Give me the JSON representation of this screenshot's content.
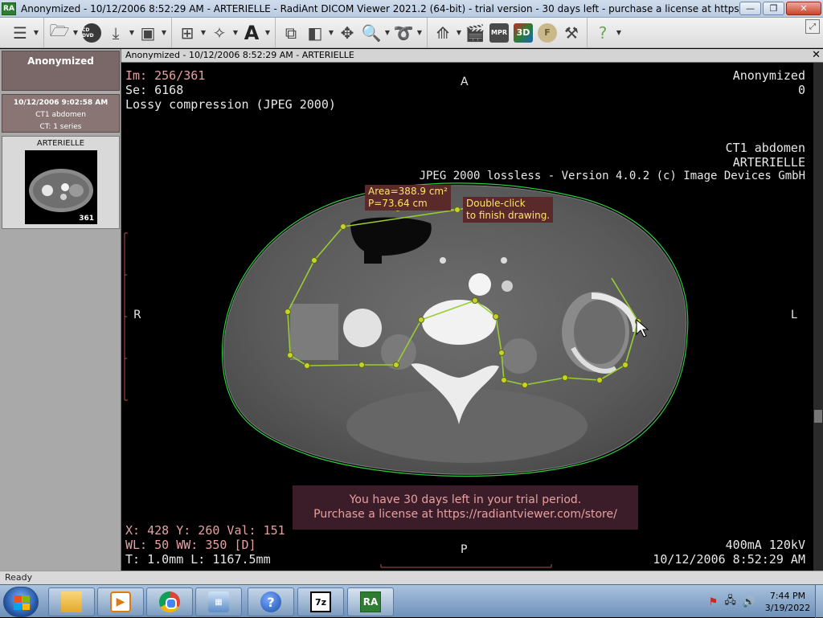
{
  "window": {
    "icon_text": "RA",
    "title": "Anonymized - 10/12/2006 8:52:29 AM - ARTERIELLE - RadiAnt DICOM Viewer 2021.2 (64-bit) - trial version - 30 days left - purchase a license at https://radiantviewer.com...",
    "minimize": "—",
    "maximize": "❐",
    "close": "✕"
  },
  "toolbar": {
    "icons": [
      "menu-icon",
      "folder-open-icon",
      "cd-dvd-icon",
      "download-icon",
      "save-icon",
      "layout-grid-icon",
      "pan-tool-icon",
      "annotation-text-icon",
      "series-stack-icon",
      "window-level-icon",
      "move-icon",
      "zoom-icon",
      "roi-freehand-icon",
      "mpr-icon",
      "cine-icon",
      "3d-icon",
      "fusion-icon",
      "tool-icon",
      "help-icon"
    ],
    "cd_label": "CD DVD",
    "mpr_label": "MPR",
    "three_d_label": "3D",
    "fusion_label": "F"
  },
  "left_panel": {
    "patient_name": "Anonymized",
    "study_date": "10/12/2006 9:02:58 AM",
    "study_desc": "CT1 abdomen",
    "study_series": "CT: 1 series",
    "series_name": "ARTERIELLE",
    "series_count": "361"
  },
  "viewer": {
    "header_title": "Anonymized - 10/12/2006 8:52:29 AM - ARTERIELLE",
    "close": "✕",
    "top_left": [
      "Im: 256/361",
      "Se: 6168",
      "Lossy compression (JPEG 2000)"
    ],
    "top_right": [
      "Anonymized",
      "0"
    ],
    "mid_right": [
      "CT1 abdomen",
      "ARTERIELLE",
      "JPEG 2000 lossless - Version 4.0.2 (c) Image Devices GmbH"
    ],
    "bottom_left": [
      "X: 428 Y: 260 Val: 151",
      "WL: 50 WW: 350 [D]",
      "T: 1.0mm L: 1167.5mm"
    ],
    "bottom_right": [
      "400mA 120kV",
      "10/12/2006 8:52:29 AM"
    ],
    "orientation": {
      "top": "A",
      "bottom": "P",
      "left": "R",
      "right": "L"
    },
    "measure": {
      "area": "Area=388.9 cm²",
      "perimeter": "P=73.64 cm"
    },
    "draw_hint": {
      "line1": "Double-click",
      "line2": "to finish drawing."
    },
    "trial": {
      "line1": "You have 30 days left in your trial period.",
      "line2": "Purchase a license at https://radiantviewer.com/store/"
    },
    "roi_color": "#9acd32",
    "contour_color": "#2ecc40"
  },
  "status": {
    "text": "Ready"
  },
  "taskbar": {
    "apps": [
      "windows-explorer",
      "media-player",
      "chrome",
      "control-panel",
      "help-support",
      "7zip",
      "radiant"
    ],
    "zip_label": "7z",
    "ra_label": "RA",
    "clock_time": "7:44 PM",
    "clock_date": "3/19/2022"
  }
}
